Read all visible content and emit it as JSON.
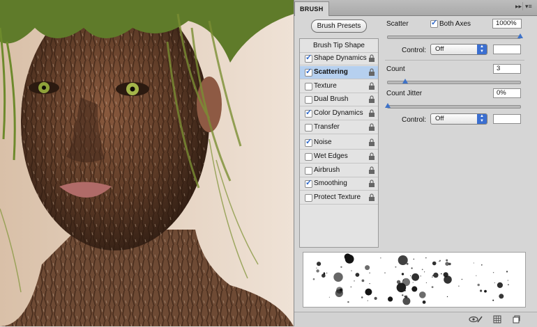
{
  "panel": {
    "tab_title": "BRUSH",
    "collapse_glyph": "▸▸",
    "menu_glyph": "▾≡",
    "presets_button": "Brush Presets",
    "tip_shape": "Brush Tip Shape"
  },
  "options": [
    {
      "label": "Shape Dynamics",
      "checked": true,
      "selected": false
    },
    {
      "label": "Scattering",
      "checked": true,
      "selected": true
    },
    {
      "label": "Texture",
      "checked": false,
      "selected": false
    },
    {
      "label": "Dual Brush",
      "checked": false,
      "selected": false
    },
    {
      "label": "Color Dynamics",
      "checked": true,
      "selected": false
    },
    {
      "label": "Transfer",
      "checked": false,
      "selected": false
    },
    {
      "label": "Noise",
      "checked": true,
      "selected": false
    },
    {
      "label": "Wet Edges",
      "checked": false,
      "selected": false
    },
    {
      "label": "Airbrush",
      "checked": false,
      "selected": false
    },
    {
      "label": "Smoothing",
      "checked": true,
      "selected": false
    },
    {
      "label": "Protect Texture",
      "checked": false,
      "selected": false
    }
  ],
  "scatter": {
    "label": "Scatter",
    "both_axes_label": "Both Axes",
    "both_axes_checked": true,
    "value": "1000%",
    "slider_fraction": 1.0,
    "control_label": "Control:",
    "control_value": "Off"
  },
  "count": {
    "label": "Count",
    "value": "3",
    "slider_fraction": 0.13
  },
  "count_jitter": {
    "label": "Count Jitter",
    "value": "0%",
    "slider_fraction": 0.0,
    "control_label": "Control:",
    "control_value": "Off"
  },
  "colors": {
    "accent": "#3b6fd1",
    "selection": "#b6d0ef"
  },
  "icons": [
    "lock-icon",
    "eye-brush-icon",
    "grid-icon",
    "new-preset-icon"
  ]
}
